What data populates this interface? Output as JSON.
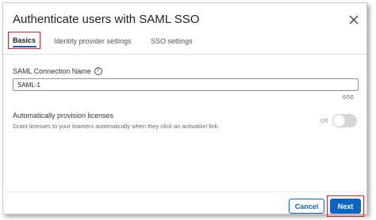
{
  "dialog": {
    "title": "Authenticate users with SAML SSO"
  },
  "tabs": [
    {
      "label": "Basics",
      "active": true
    },
    {
      "label": "Identity provider settings",
      "active": false
    },
    {
      "label": "SSO settings",
      "active": false
    }
  ],
  "connection_name": {
    "label": "SAML Connection Name",
    "help_symbol": "?",
    "value": "SAML-1",
    "counter": "6/50"
  },
  "provisioning": {
    "title": "Automatically provision licenses",
    "description": "Grant licenses to your learners automatically when they click an activation link.",
    "toggle_state_label": "Off",
    "enabled": false
  },
  "footer": {
    "cancel_label": "Cancel",
    "next_label": "Next"
  },
  "colors": {
    "accent": "#0a66c2",
    "highlight_outline": "#d9262f"
  },
  "icons": {
    "close": "close-icon",
    "help": "help-icon"
  }
}
